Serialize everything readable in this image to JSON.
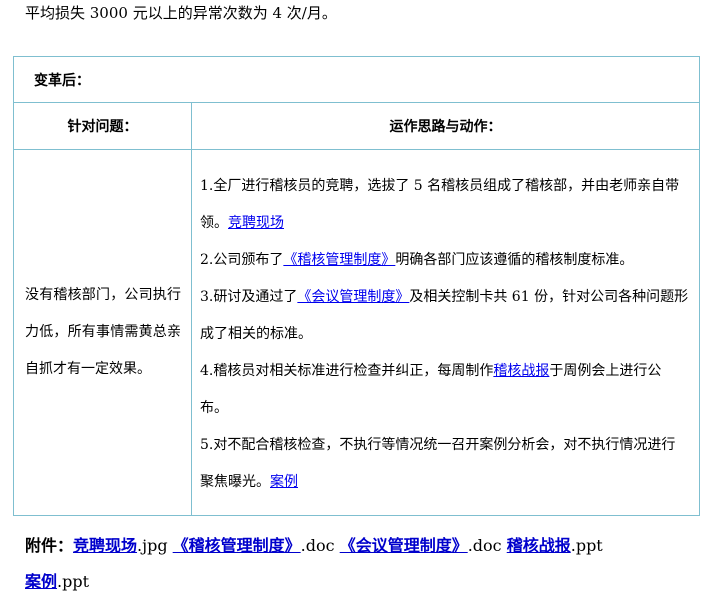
{
  "intro_text": "平均损失 3000 元以上的异常次数为 4 次/月。",
  "section_title": "变革后：",
  "headers": {
    "problem": "针对问题：",
    "actions": "运作思路与动作："
  },
  "problem_text": "没有稽核部门，公司执行力低，所有事情需黄总亲自抓才有一定效果。",
  "actions": [
    {
      "before": "1.全厂进行稽核员的竞聘，选拔了 5 名稽核员组成了稽核部，并由老师亲自带领。",
      "link": "竞聘现场",
      "after": ""
    },
    {
      "before": "2.公司颁布了",
      "link": "《稽核管理制度》",
      "after": "明确各部门应该遵循的稽核制度标准。"
    },
    {
      "before": "3.研讨及通过了",
      "link": "《会议管理制度》",
      "after": "及相关控制卡共 61 份，针对公司各种问题形成了相关的标准。"
    },
    {
      "before": "4.稽核员对相关标准进行检查并纠正，每周制作",
      "link": "稽核战报",
      "after": "于周例会上进行公布。"
    },
    {
      "before": "5.对不配合稽核检查，不执行等情况统一召开案例分析会，对不执行情况进行聚焦曝光。",
      "link": "案例",
      "after": ""
    }
  ],
  "attachments": {
    "label": "附件：",
    "files": [
      {
        "name": "竞聘现场",
        "ext": ".jpg"
      },
      {
        "name": "《稽核管理制度》",
        "ext": ".doc"
      },
      {
        "name": "《会议管理制度》",
        "ext": ".doc"
      },
      {
        "name": "稽核战报",
        "ext": ".ppt"
      },
      {
        "name": "案例",
        "ext": ".ppt"
      }
    ]
  }
}
